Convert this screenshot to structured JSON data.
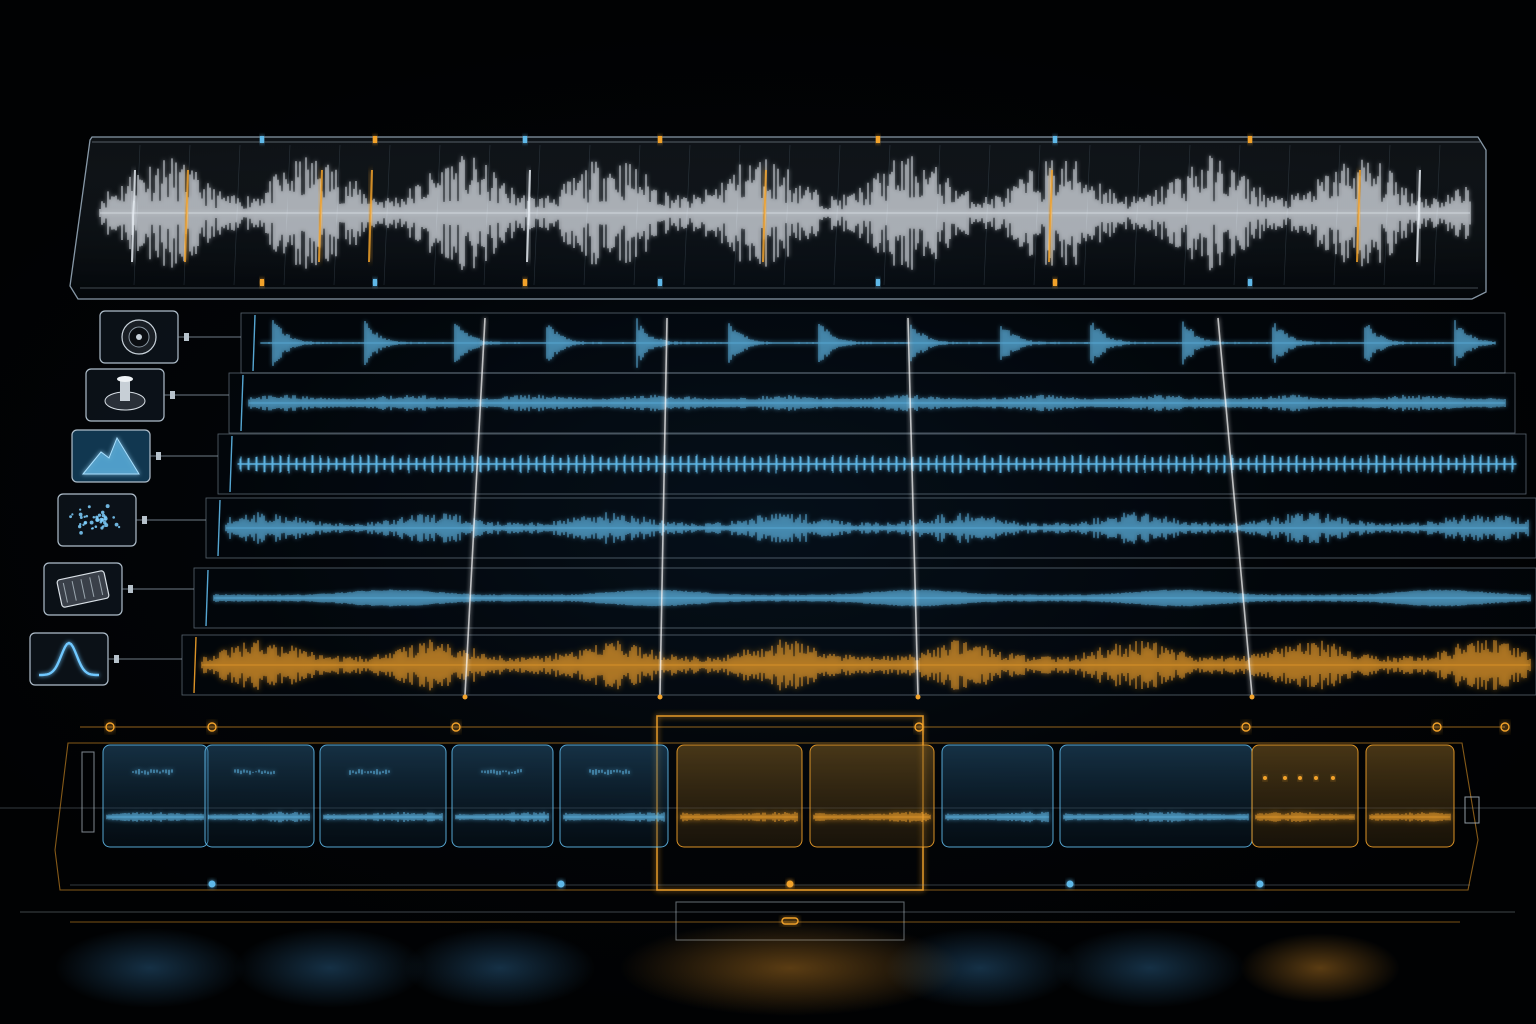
{
  "colors": {
    "background": "#010203",
    "master_wave": "#e8eef4",
    "cyan_wave": "#5fb8e8",
    "amber_wave": "#f2a22a",
    "glass_edge": "#9fb3c4",
    "playhead": "#ffffff"
  },
  "master_track": {
    "marker_colors": [
      "cyan",
      "amber",
      "cyan",
      "amber",
      "amber",
      "cyan",
      "amber"
    ]
  },
  "tracks": [
    {
      "icon": "speaker-icon",
      "wave_style": "transient",
      "color": "cyan"
    },
    {
      "icon": "metronome-icon",
      "wave_style": "dense",
      "color": "cyan"
    },
    {
      "icon": "mountain-icon",
      "wave_style": "ticks",
      "color": "cyan"
    },
    {
      "icon": "particles-icon",
      "wave_style": "bursts",
      "color": "cyan"
    },
    {
      "icon": "chip-icon",
      "wave_style": "smooth",
      "color": "cyan"
    },
    {
      "icon": "curve-icon",
      "wave_style": "bursts",
      "color": "amber"
    }
  ],
  "timeline": {
    "clip_colors": [
      "cyan",
      "cyan",
      "cyan",
      "cyan",
      "cyan",
      "amber",
      "amber",
      "cyan",
      "cyan",
      "amber",
      "amber"
    ]
  }
}
